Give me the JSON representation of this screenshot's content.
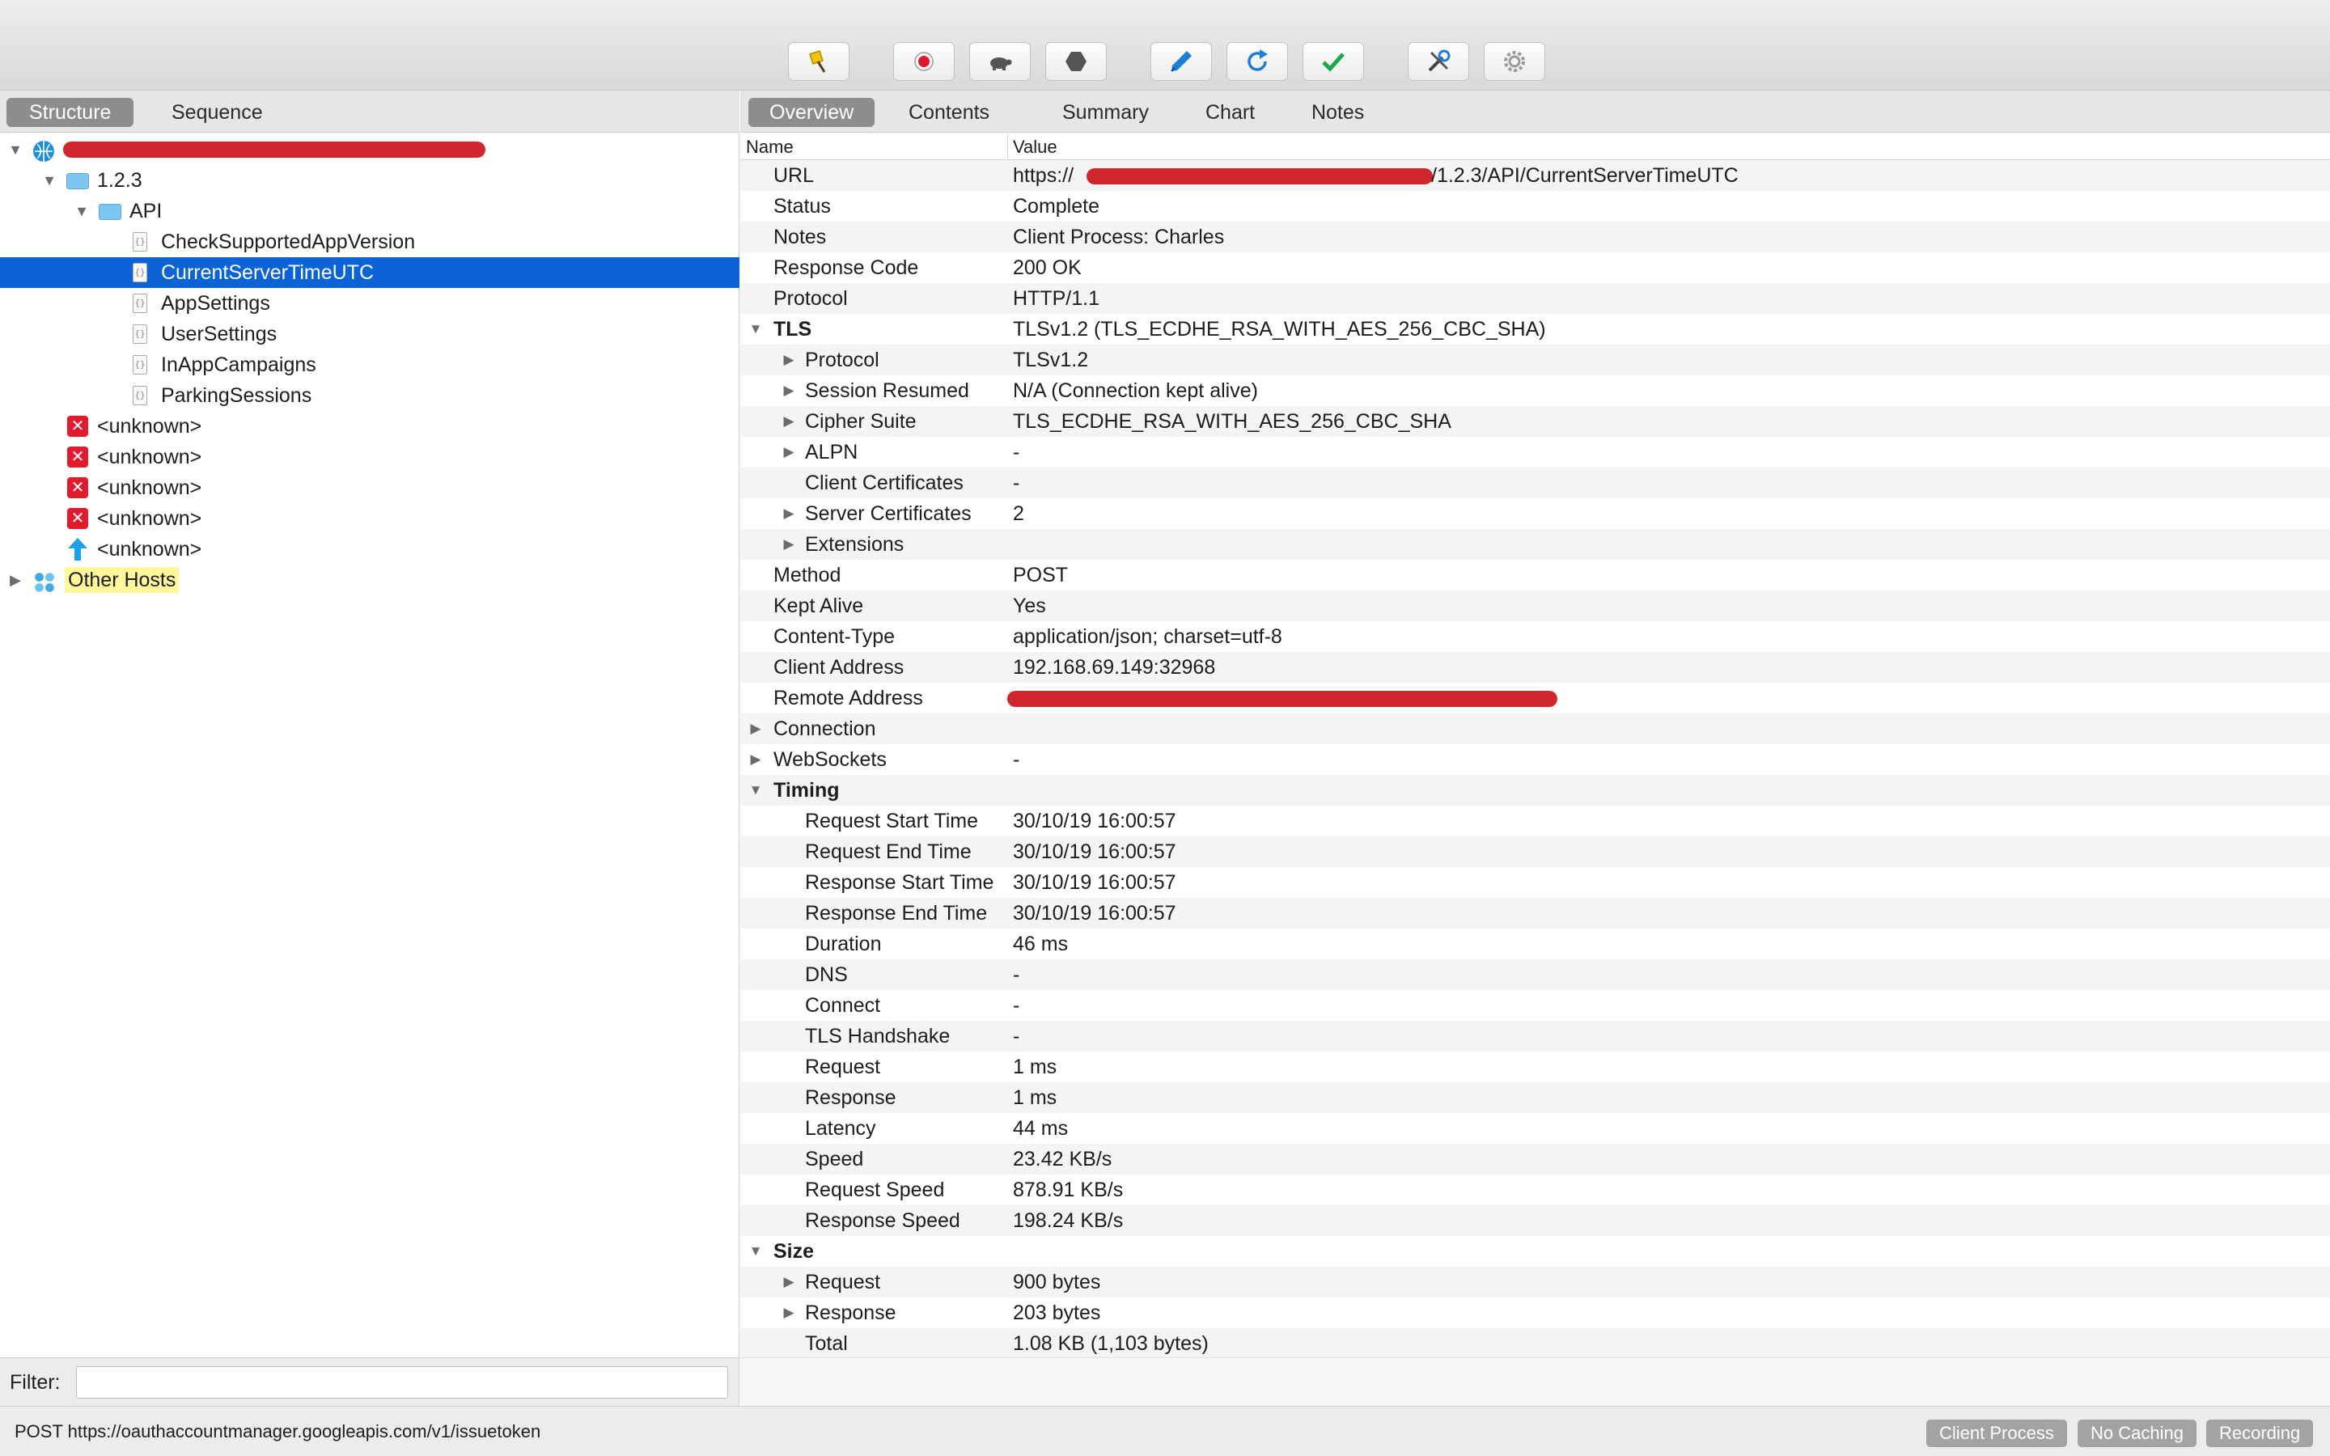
{
  "toolbar": {
    "buttons": [
      {
        "name": "broom-icon",
        "color": "#f2c400"
      },
      {
        "name": "record-icon",
        "color": "#e0182d"
      },
      {
        "name": "throttle-turtle-icon",
        "color": "#555555"
      },
      {
        "name": "stop-hexagon-icon",
        "color": "#555555"
      },
      {
        "name": "pen-edit-icon",
        "color": "#1d7ed8"
      },
      {
        "name": "refresh-icon",
        "color": "#1d7ed8"
      },
      {
        "name": "checkmark-icon",
        "color": "#1aa84a"
      },
      {
        "name": "tools-icon",
        "color": "#555555"
      },
      {
        "name": "settings-gear-icon",
        "color": "#9a9a9a"
      }
    ]
  },
  "left": {
    "tabs": [
      "Structure",
      "Sequence"
    ],
    "active_tab": "Structure",
    "tree": [
      {
        "label": "",
        "level": 0,
        "icon": "globe-icon",
        "expanded": true,
        "redacted": true
      },
      {
        "label": "1.2.3",
        "level": 1,
        "icon": "folder-icon",
        "expanded": true
      },
      {
        "label": "API",
        "level": 2,
        "icon": "folder-icon",
        "expanded": true
      },
      {
        "label": "CheckSupportedAppVersion",
        "level": 3,
        "icon": "json-document-icon"
      },
      {
        "label": "CurrentServerTimeUTC",
        "level": 3,
        "icon": "json-document-icon",
        "selected": true
      },
      {
        "label": "AppSettings",
        "level": 3,
        "icon": "json-document-icon"
      },
      {
        "label": "UserSettings",
        "level": 3,
        "icon": "json-document-icon"
      },
      {
        "label": "InAppCampaigns",
        "level": 3,
        "icon": "json-document-icon"
      },
      {
        "label": "ParkingSessions",
        "level": 3,
        "icon": "json-document-icon"
      },
      {
        "label": "<unknown>",
        "level": 1,
        "icon": "error-icon"
      },
      {
        "label": "<unknown>",
        "level": 1,
        "icon": "error-icon"
      },
      {
        "label": "<unknown>",
        "level": 1,
        "icon": "error-icon"
      },
      {
        "label": "<unknown>",
        "level": 1,
        "icon": "error-icon"
      },
      {
        "label": "<unknown>",
        "level": 1,
        "icon": "upload-arrow-icon"
      },
      {
        "label": "Other Hosts",
        "level": 0,
        "icon": "hosts-icon",
        "expanded": false,
        "highlight": "#fff79a"
      }
    ],
    "filter_label": "Filter:",
    "filter_value": ""
  },
  "right": {
    "tabs": [
      "Overview",
      "Contents",
      "Summary",
      "Chart",
      "Notes"
    ],
    "active_tab": "Overview",
    "columns": [
      "Name",
      "Value"
    ],
    "rows": [
      {
        "name": "URL",
        "value": "https://",
        "value_suffix": "/1.2.3/API/CurrentServerTimeUTC",
        "indent": 0,
        "redacted_host": true
      },
      {
        "name": "Status",
        "value": "Complete",
        "indent": 0
      },
      {
        "name": "Notes",
        "value": "Client Process: Charles",
        "indent": 0
      },
      {
        "name": "Response Code",
        "value": "200 OK",
        "indent": 0
      },
      {
        "name": "Protocol",
        "value": "HTTP/1.1",
        "indent": 0
      },
      {
        "name": "TLS",
        "value": "TLSv1.2 (TLS_ECDHE_RSA_WITH_AES_256_CBC_SHA)",
        "indent": 0,
        "toggle": "open",
        "bold": true
      },
      {
        "name": "Protocol",
        "value": "TLSv1.2",
        "indent": 1,
        "toggle": "closed"
      },
      {
        "name": "Session Resumed",
        "value": "N/A (Connection kept alive)",
        "indent": 1,
        "toggle": "closed"
      },
      {
        "name": "Cipher Suite",
        "value": "TLS_ECDHE_RSA_WITH_AES_256_CBC_SHA",
        "indent": 1,
        "toggle": "closed"
      },
      {
        "name": "ALPN",
        "value": "-",
        "indent": 1,
        "toggle": "closed"
      },
      {
        "name": "Client Certificates",
        "value": "-",
        "indent": 1
      },
      {
        "name": "Server Certificates",
        "value": "2",
        "indent": 1,
        "toggle": "closed"
      },
      {
        "name": "Extensions",
        "value": "",
        "indent": 1,
        "toggle": "closed"
      },
      {
        "name": "Method",
        "value": "POST",
        "indent": 0
      },
      {
        "name": "Kept Alive",
        "value": "Yes",
        "indent": 0
      },
      {
        "name": "Content-Type",
        "value": "application/json; charset=utf-8",
        "indent": 0
      },
      {
        "name": "Client Address",
        "value": "192.168.69.149:32968",
        "indent": 0
      },
      {
        "name": "Remote Address",
        "value": "",
        "indent": 0,
        "redacted_value": true
      },
      {
        "name": "Connection",
        "value": "",
        "indent": 0,
        "toggle": "closed"
      },
      {
        "name": "WebSockets",
        "value": "-",
        "indent": 0,
        "toggle": "closed"
      },
      {
        "name": "Timing",
        "value": "",
        "indent": 0,
        "toggle": "open",
        "bold": true
      },
      {
        "name": "Request Start Time",
        "value": "30/10/19 16:00:57",
        "indent": 1
      },
      {
        "name": "Request End Time",
        "value": "30/10/19 16:00:57",
        "indent": 1
      },
      {
        "name": "Response Start Time",
        "value": "30/10/19 16:00:57",
        "indent": 1
      },
      {
        "name": "Response End Time",
        "value": "30/10/19 16:00:57",
        "indent": 1
      },
      {
        "name": "Duration",
        "value": "46 ms",
        "indent": 1
      },
      {
        "name": "DNS",
        "value": "-",
        "indent": 1
      },
      {
        "name": "Connect",
        "value": "-",
        "indent": 1
      },
      {
        "name": "TLS Handshake",
        "value": "-",
        "indent": 1
      },
      {
        "name": "Request",
        "value": "1 ms",
        "indent": 1
      },
      {
        "name": "Response",
        "value": "1 ms",
        "indent": 1
      },
      {
        "name": "Latency",
        "value": "44 ms",
        "indent": 1
      },
      {
        "name": "Speed",
        "value": "23.42 KB/s",
        "indent": 1
      },
      {
        "name": "Request Speed",
        "value": "878.91 KB/s",
        "indent": 1
      },
      {
        "name": "Response Speed",
        "value": "198.24 KB/s",
        "indent": 1
      },
      {
        "name": "Size",
        "value": "",
        "indent": 0,
        "toggle": "open",
        "bold": true
      },
      {
        "name": "Request",
        "value": "900 bytes",
        "indent": 1,
        "toggle": "closed"
      },
      {
        "name": "Response",
        "value": "203 bytes",
        "indent": 1,
        "toggle": "closed"
      },
      {
        "name": "Total",
        "value": "1.08 KB (1,103 bytes)",
        "indent": 1
      }
    ]
  },
  "status": {
    "text": "POST https://oauthaccountmanager.googleapis.com/v1/issuetoken",
    "buttons": [
      "Client Process",
      "No Caching",
      "Recording"
    ]
  },
  "colors": {
    "selection": "#0b63d6",
    "redaction": "#d0262e",
    "highlight": "#fff79a"
  }
}
